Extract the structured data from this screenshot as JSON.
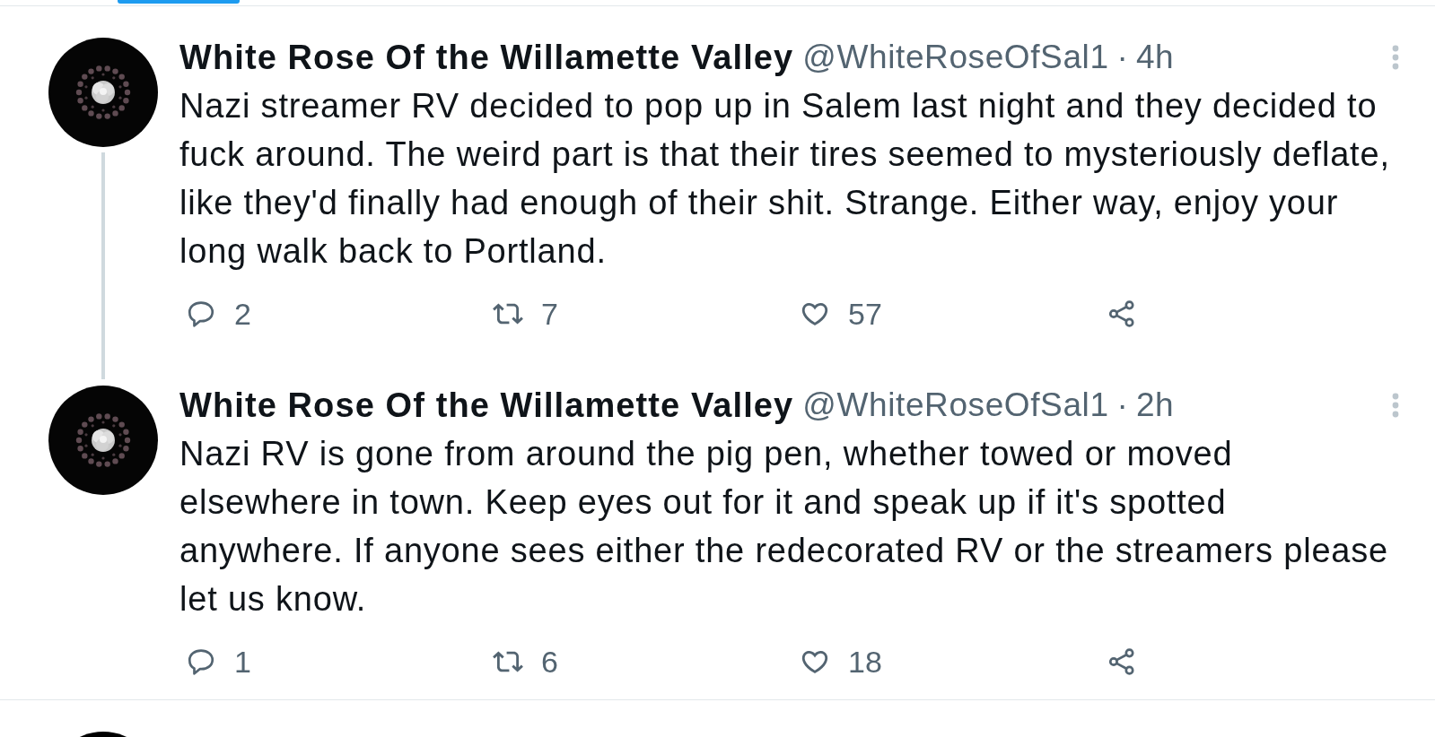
{
  "tweets": [
    {
      "author": "White Rose Of the Willamette Valley",
      "handle": "@WhiteRoseOfSal1",
      "separator": "·",
      "time": "4h",
      "thread_continues": true,
      "text": "Nazi streamer RV decided to pop up in Salem last night and they decided to fuck around. The weird part is that their tires seemed to mysteriously deflate, like they'd finally had enough of their shit. Strange. Either way, enjoy your long walk back to Portland.",
      "actions": [
        {
          "kind": "reply",
          "count": "2"
        },
        {
          "kind": "retweet",
          "count": "7"
        },
        {
          "kind": "like",
          "count": "57"
        },
        {
          "kind": "share"
        }
      ]
    },
    {
      "author": "White Rose Of the Willamette Valley",
      "handle": "@WhiteRoseOfSal1",
      "separator": "·",
      "time": "2h",
      "thread_continues": false,
      "text": "Nazi RV is gone from around the pig pen, whether towed or moved elsewhere in town. Keep eyes out for it and speak up if it's spotted anywhere. If anyone sees either the redecorated RV or the streamers please let us know.",
      "actions": [
        {
          "kind": "reply",
          "count": "1"
        },
        {
          "kind": "retweet",
          "count": "6"
        },
        {
          "kind": "like",
          "count": "18"
        },
        {
          "kind": "share"
        }
      ]
    }
  ]
}
